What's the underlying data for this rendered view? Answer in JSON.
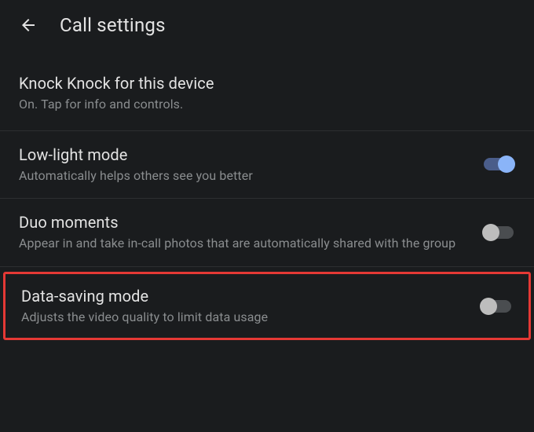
{
  "header": {
    "title": "Call settings"
  },
  "settings": {
    "knock_knock": {
      "title": "Knock Knock for this device",
      "subtitle": "On. Tap for info and controls."
    },
    "low_light": {
      "title": "Low-light mode",
      "subtitle": "Automatically helps others see you better"
    },
    "duo_moments": {
      "title": "Duo moments",
      "subtitle": "Appear in and take in-call photos that are automatically shared with the group"
    },
    "data_saving": {
      "title": "Data-saving mode",
      "subtitle": "Adjusts the video quality to limit data usage"
    }
  }
}
